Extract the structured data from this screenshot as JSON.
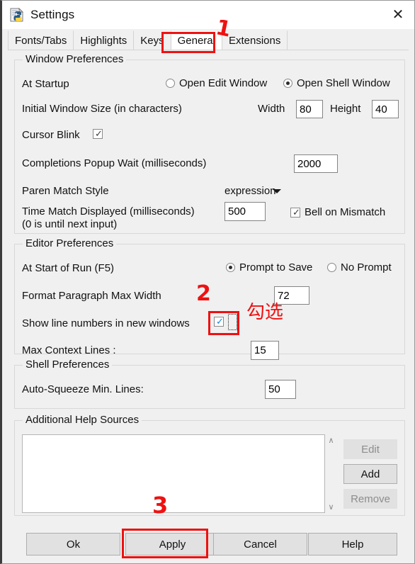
{
  "window": {
    "title": "Settings",
    "icon": "python-idle-icon",
    "close_label": "✕"
  },
  "tabs": [
    {
      "label": "Fonts/Tabs",
      "active": false
    },
    {
      "label": "Highlights",
      "active": false
    },
    {
      "label": "Keys",
      "active": false
    },
    {
      "label": "General",
      "active": true
    },
    {
      "label": "Extensions",
      "active": false
    }
  ],
  "window_preferences": {
    "group_title": "Window Preferences",
    "at_startup_label": "At Startup",
    "startup_options": [
      {
        "label": "Open Edit Window",
        "selected": false
      },
      {
        "label": "Open Shell Window",
        "selected": true
      }
    ],
    "initial_window_size_label": "Initial Window Size  (in characters)",
    "width_label": "Width",
    "width_value": "80",
    "height_label": "Height",
    "height_value": "40",
    "cursor_blink_label": "Cursor Blink",
    "cursor_blink_checked": true,
    "completions_popup_label": "Completions Popup Wait (milliseconds)",
    "completions_popup_value": "2000",
    "paren_match_style_label": "Paren Match Style",
    "paren_match_style_value": "expression",
    "time_match_label_line1": "Time Match Displayed (milliseconds)",
    "time_match_label_line2": "(0 is until next input)",
    "time_match_value": "500",
    "bell_on_mismatch_label": "Bell on Mismatch",
    "bell_on_mismatch_checked": true
  },
  "editor_preferences": {
    "group_title": "Editor Preferences",
    "at_start_of_run_label": "At Start of Run (F5)",
    "run_options": [
      {
        "label": "Prompt to Save",
        "selected": true
      },
      {
        "label": "No Prompt",
        "selected": false
      }
    ],
    "format_paragraph_label": "Format Paragraph Max Width",
    "format_paragraph_value": "72",
    "show_line_numbers_label": "Show line numbers in new windows",
    "show_line_numbers_checked": true,
    "max_context_lines_label": "Max Context Lines :",
    "max_context_lines_value": "15"
  },
  "shell_preferences": {
    "group_title": "Shell Preferences",
    "auto_squeeze_label": "Auto-Squeeze Min. Lines:",
    "auto_squeeze_value": "50"
  },
  "additional_help_sources": {
    "group_title": "Additional Help Sources",
    "list_items": [],
    "edit_label": "Edit",
    "edit_enabled": false,
    "add_label": "Add",
    "add_enabled": true,
    "remove_label": "Remove",
    "remove_enabled": false,
    "scroll_up_glyph": "∧",
    "scroll_down_glyph": "∨"
  },
  "footer": {
    "ok_label": "Ok",
    "apply_label": "Apply",
    "cancel_label": "Cancel",
    "help_label": "Help"
  },
  "annotations": {
    "step1": "1",
    "step2": "2",
    "step3": "3",
    "checkbox_note": "勾选",
    "color": "#ee1111"
  }
}
